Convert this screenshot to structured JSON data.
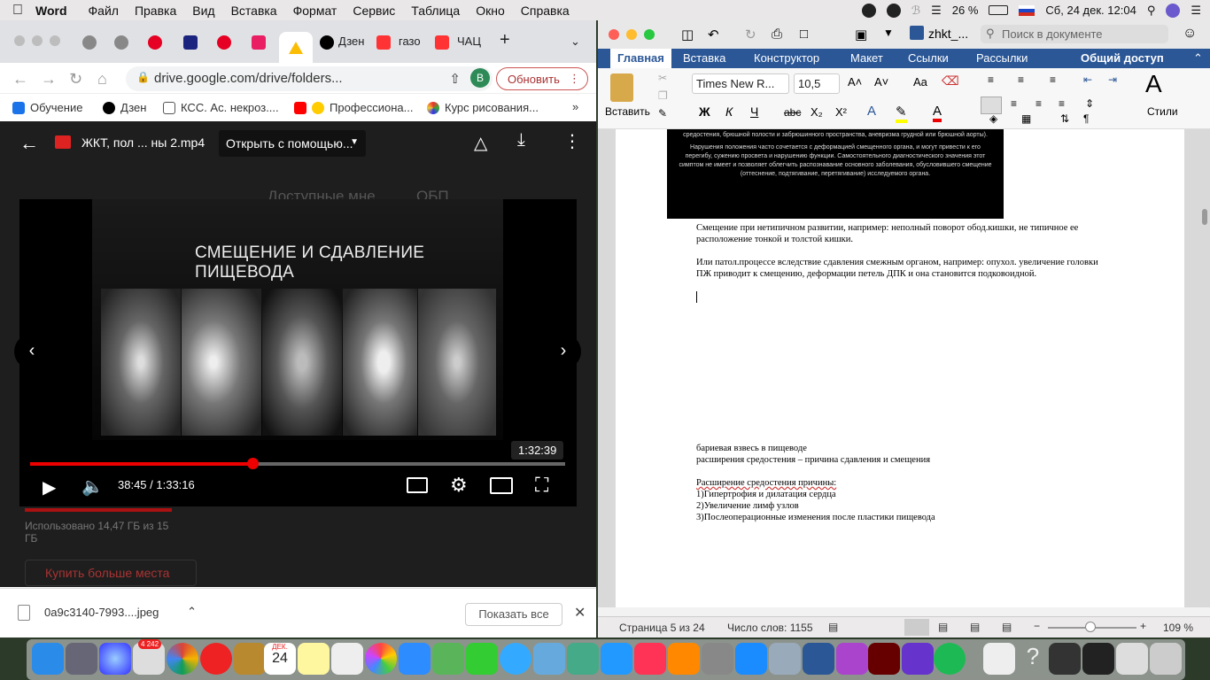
{
  "menubar": {
    "app": "Word",
    "items": [
      "Файл",
      "Правка",
      "Вид",
      "Вставка",
      "Формат",
      "Сервис",
      "Таблица",
      "Окно",
      "Справка"
    ],
    "battery": "26 %",
    "datetime": "Сб, 24 дек.  12:04"
  },
  "chrome": {
    "tabs": [
      {
        "label": "Дзен"
      },
      {
        "label": "газо"
      },
      {
        "label": "ЧАЦ"
      }
    ],
    "url": "drive.google.com/drive/folders...",
    "update_label": "Обновить",
    "profile_initial": "В",
    "bookmarks": [
      "Обучение",
      "Дзен",
      "КСС. Ас. некроз....",
      "Профессиона...",
      "Курс рисования..."
    ]
  },
  "viewer": {
    "file_title": "ЖКТ, пол ... ны 2.mp4",
    "open_with": "Открыть с помощью...",
    "slide_title": "СМЕЩЕНИЕ И СДАВЛЕНИЕ ПИЩЕВОДА",
    "time_display": "38:45 / 1:33:16",
    "hover_time": "1:32:39",
    "progress_fraction": 0.416,
    "bg_texts": {
      "storage": "Использовано 14,47 ГБ из 15 ГБ",
      "buy": "Купить больше места",
      "available": "Доступные мне",
      "folder": "ОБП"
    }
  },
  "downloads": {
    "file": "0a9c3140-7993....jpeg",
    "show_all": "Показать все"
  },
  "word": {
    "doc_name": "zhkt_...",
    "search_placeholder": "Поиск в документе",
    "tabs": [
      "Главная",
      "Вставка",
      "Конструктор",
      "Макет",
      "Ссылки",
      "Рассылки",
      "Общий доступ"
    ],
    "font": "Times New R...",
    "size": "10,5",
    "paste": "Вставить",
    "styles": "Стили",
    "image_text": [
      "средостения, брюшной полости и забрюшинного пространства, аневризма грудной или брюшной аорты).",
      "Нарушения положения часто сочетается с деформацией смещенного органа, и могут привести к его перегибу, сужению просвета и нарушению функции. Самостоятельного диагностического значения этот симптом не имеет и позволяет облегчить распознавание основного заболевания, обусловившего смещение (оттеснение, подтягивание, перетягивание) исследуемого органа."
    ],
    "lines": [
      "Смещение при нетипичном развитии, например: неполный поворот обод.кишки, не типичное ее",
      "расположение тонкой и толстой кишки.",
      "Или патол.процессе вследствие сдавления смежным органом, например: опухол. увеличение головки",
      "ПЖ приводит к смещению, деформации петель ДПК и она становится подковоидной.",
      "бариевая взвесь в пищеводе",
      "расширения средостения – причина сдавления и смещения",
      "Расширение средостения причины:",
      "1)Гипертрофия и дилатация сердца",
      "2)Увеличение лимф узлов",
      "3)Послеоперационные изменения после пластики пищевода"
    ],
    "status": {
      "page": "Страница 5 из 24",
      "words": "Число слов: 1155",
      "zoom": "109 %"
    }
  },
  "dock": {
    "badge": "4 242",
    "calendar_month": "ДЕК.",
    "calendar_day": "24"
  }
}
